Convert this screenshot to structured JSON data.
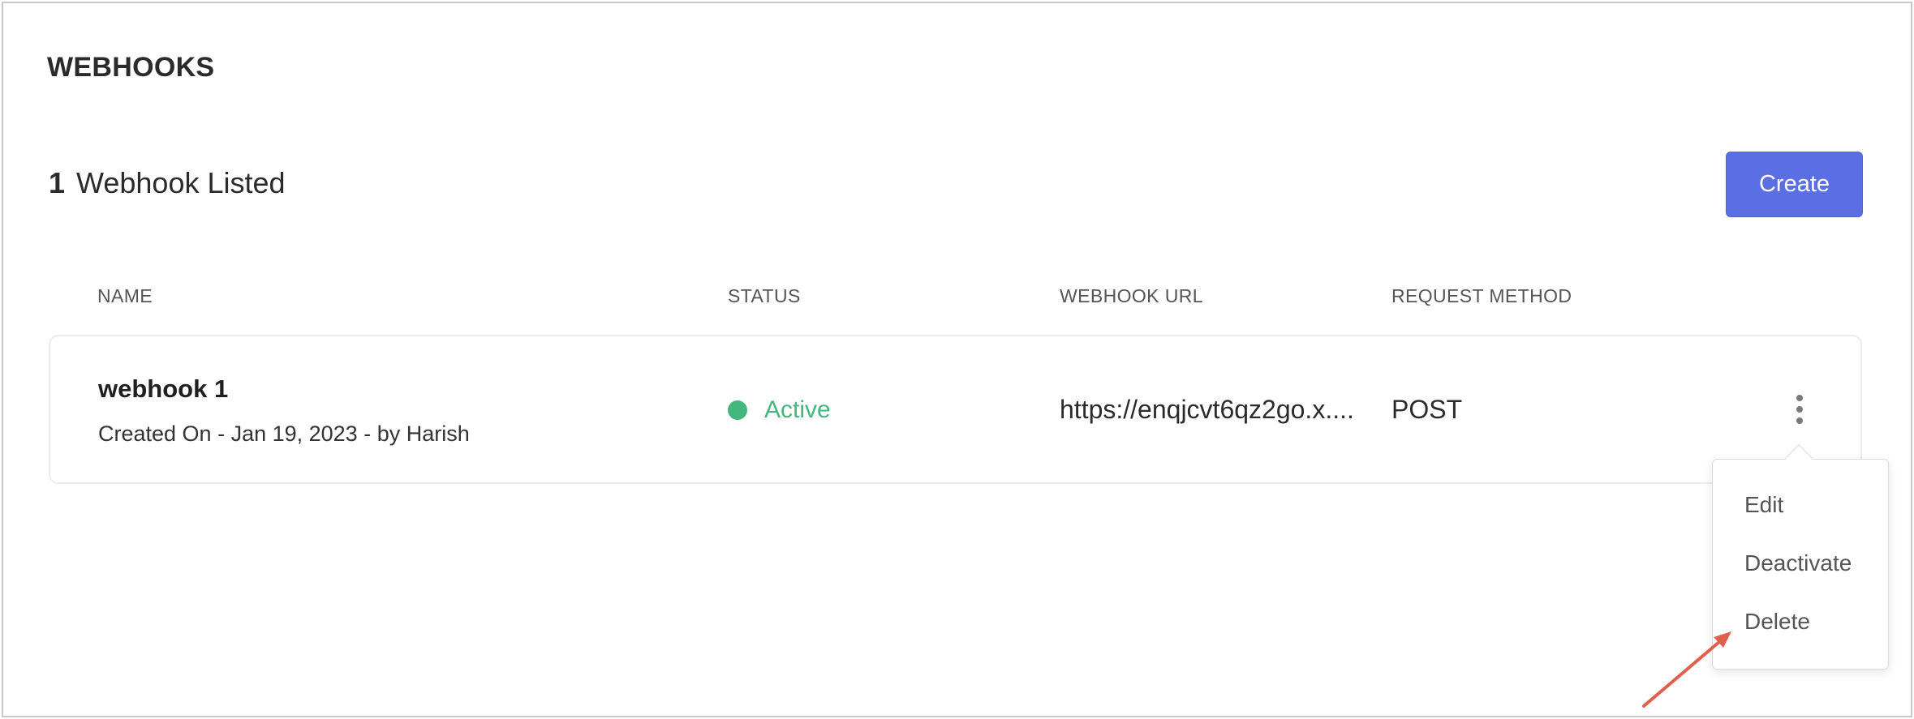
{
  "page": {
    "title": "WEBHOOKS"
  },
  "summary": {
    "count": "1",
    "label": "Webhook Listed"
  },
  "actions": {
    "create_label": "Create"
  },
  "table": {
    "columns": [
      "NAME",
      "STATUS",
      "WEBHOOK URL",
      "REQUEST METHOD"
    ],
    "rows": [
      {
        "name": "webhook 1",
        "created": "Created On - Jan 19, 2023 - by Harish",
        "status": "Active",
        "url": "https://enqjcvt6qz2go.x....",
        "method": "POST"
      }
    ]
  },
  "row_menu": {
    "items": [
      "Edit",
      "Deactivate",
      "Delete"
    ]
  },
  "icons": {
    "kebab": "more-vertical-icon",
    "status": "status-dot-icon"
  },
  "colors": {
    "accent": "#5b6fe4",
    "active": "#43b77d",
    "annotation": "#e0604e"
  }
}
